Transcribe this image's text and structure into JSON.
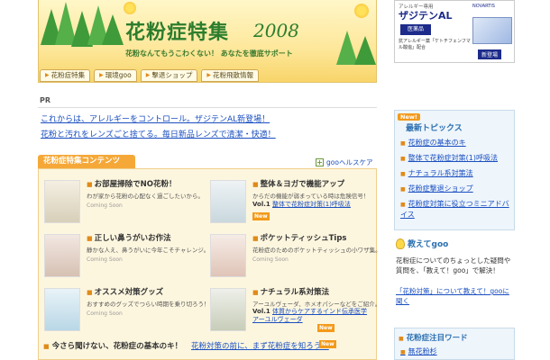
{
  "header": {
    "title": "花粉症特集",
    "year": "2008",
    "subtitle": "花粉なんてもうこわくない！ あなたを徹底サポート",
    "nav": [
      "花粉症特集",
      "環境goo",
      "撃退ショップ",
      "花粉飛散情報"
    ]
  },
  "ad": {
    "head": "アレルギー専用",
    "brand": "ザジテンAL",
    "maker": "NOVARTIS",
    "box": "医薬品",
    "text": "抗アレルギー薬「ケトチフェンフマル酸塩」配合",
    "new": "新登場"
  },
  "pr": {
    "label": "PR",
    "links": [
      "これからは、アレルギーをコントロール。ザジテンAL新登場！",
      "花粉と汚れをレンズごと捨てる。毎日新品レンズで清潔・快適！"
    ]
  },
  "contents": {
    "tab": "花粉症特集コンテンツ",
    "goo_health": "gooヘルスケア",
    "cards": [
      {
        "title": "お部屋掃除でNO花粉！",
        "desc": "わが家から花粉の心配なく過ごしたいから。",
        "soon": "Coming Soon"
      },
      {
        "title": "整体＆ヨガで機能アップ",
        "desc": "からだの機能が弱まっている時は危険信号！",
        "vol": "Vol.1",
        "link": "整体で花粉症対策(1)呼吸法",
        "new": "New"
      },
      {
        "title": "正しい鼻うがいお作法",
        "desc": "静かな人え、鼻うがいに今年こそチャレンジ。",
        "soon": "Coming Soon"
      },
      {
        "title": "ポケットティッシュTips",
        "desc": "花粉症のためのポケットティッシュの小ワザ集。",
        "soon": "Coming Soon"
      },
      {
        "title": "オススメ対策グッズ",
        "desc": "おすすめのグッズでつらい時期を乗り切ろう！",
        "soon": "Coming Soon"
      },
      {
        "title": "ナチュラル系対策法",
        "desc": "アーユルヴェーダ、ホメオパシーなどをご紹介。",
        "vol": "Vol.1",
        "link": "体質からケアするインド伝承医学 アーユルヴェーダ",
        "new": "New"
      }
    ],
    "bottom": "今さら聞けない、花粉症の基本のキ！",
    "bottom_link": "花粉対策の前に、まず花粉症を知ろう！",
    "bottom_new": "New"
  },
  "sidebar": {
    "new_badge": "New!",
    "topics_title": "最新トピックス",
    "topics": [
      "花粉症の基本のキ",
      "整体で花粉症対策(1)呼吸法",
      "ナチュラル系対策法",
      "花粉症撃退ショップ",
      "花粉症対策に役立つミニアドバイス"
    ],
    "ask_title": "教えてgoo",
    "ask_text": "花粉症についてのちょっとした疑問や質問を、「教えて！goo」で解決！",
    "ask_link": "「花粉対策」について教えて！gooに聞く",
    "words_title": "花粉症注目ワード",
    "words_item": "無花粉杉"
  },
  "colors": {
    "accent": "#f5a838",
    "title_green": "#2c7d2d",
    "link": "#1a4fc0",
    "side_title": "#2b6fb0"
  }
}
